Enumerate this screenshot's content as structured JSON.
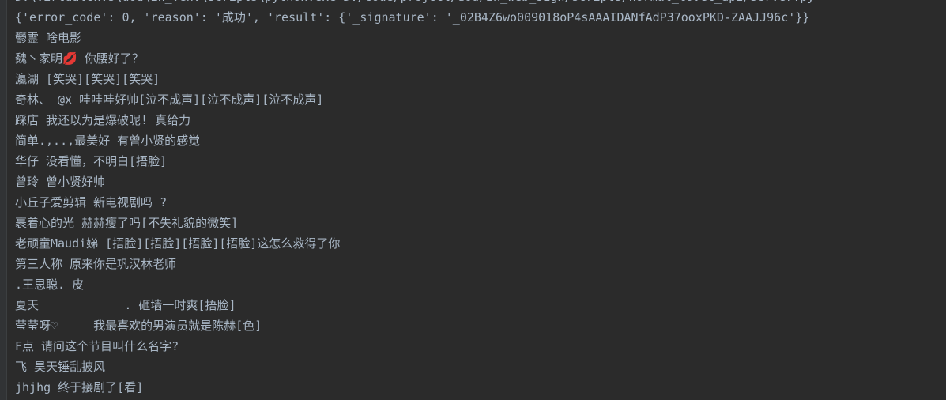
{
  "console": {
    "command": "D:\\virtualenvs\\dou\\in_venv\\Scripts\\python.exe D:/code/project/dou/in_web_sign/scripts/normal_tovet_api/server.py",
    "lines": [
      "{'error_code': 0, 'reason': '成功', 'result': {'_signature': '_02B4Z6wo009018oP4sAAAIDANfAdP37ooxPKD-ZAAJJ96c'}}",
      "鬱霊 啥电影",
      "魏丶家明💋 你腰好了？",
      "瀛湖 [笑哭][笑哭][笑哭]",
      "奇林、 @x 哇哇哇好帅[泣不成声][泣不成声][泣不成声]",
      "踩店 我还以为是爆破呢! 真给力",
      "简单.,..,最美好 有曾小贤的感觉",
      "华仔 没看懂，不明白[捂脸]",
      "曾玲 曾小贤好帅",
      "小丘子爱剪辑 新电视剧吗 ?",
      "裹着心的光 赫赫瘦了吗[不失礼貌的微笑]",
      "老顽童Maudi娣 [捂脸][捂脸][捂脸][捂脸]这怎么救得了你",
      "第三人称 原来你是巩汉林老师",
      ".王思聪. 皮",
      "夏天            . 砸墙一时爽[捂脸]",
      "莹莹呀♡     我最喜欢的男演员就是陈赫[色]",
      "F点 请问这个节目叫什么名字?",
      "飞 昊天锤乱披风",
      "jhjhg 终于接剧了[看]"
    ]
  }
}
